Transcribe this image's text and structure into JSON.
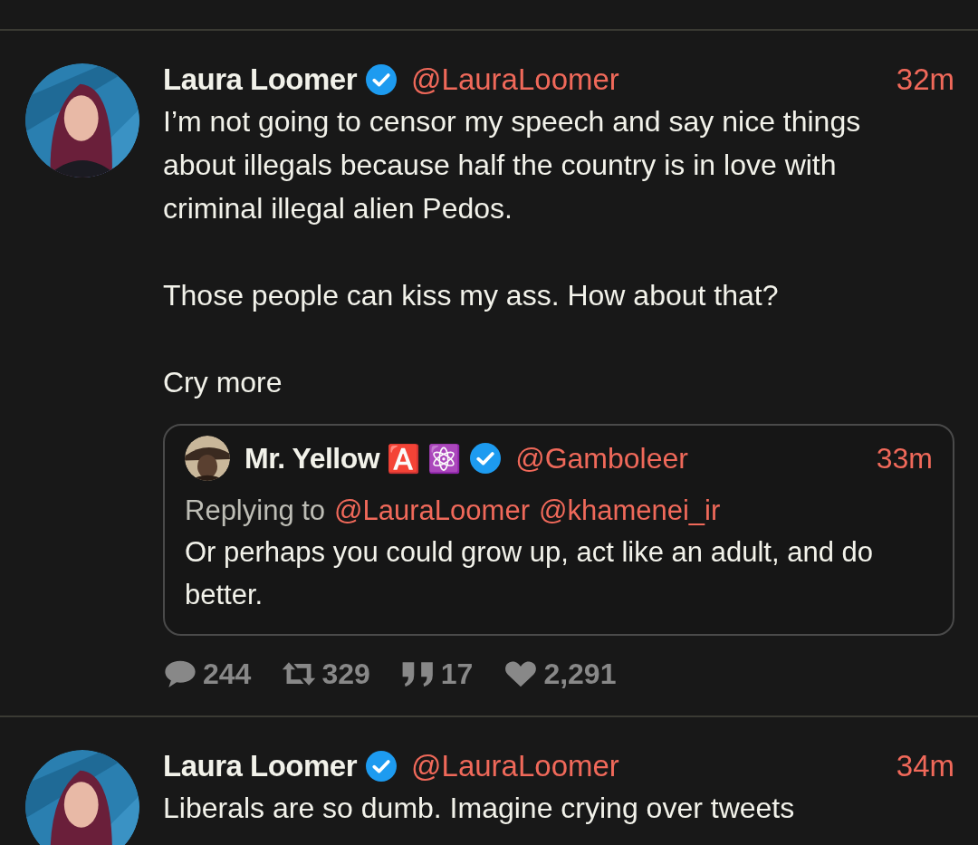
{
  "tweets": [
    {
      "name": "Laura Loomer",
      "verified": true,
      "handle": "@LauraLoomer",
      "time": "32m",
      "text": "I’m not going to censor my speech and say nice things about illegals because half the country is in love with criminal illegal alien Pedos.\n\nThose people can kiss my ass. How about that?\n\nCry more",
      "quote": {
        "name": "Mr. Yellow",
        "emojis": [
          "🅰️",
          "⚛️"
        ],
        "verified": true,
        "handle": "@Gamboleer",
        "time": "33m",
        "replying_label": "Replying to",
        "replying_to": [
          "@LauraLoomer",
          "@khamenei_ir"
        ],
        "text": "Or perhaps you could grow up, act like an adult, and do better."
      },
      "stats": [
        {
          "kind": "reply",
          "count": "244"
        },
        {
          "kind": "retweet",
          "count": "329"
        },
        {
          "kind": "quote",
          "count": "17"
        },
        {
          "kind": "like",
          "count": "2,291"
        }
      ]
    },
    {
      "name": "Laura Loomer",
      "verified": true,
      "handle": "@LauraLoomer",
      "time": "34m",
      "text": "Liberals are so dumb. Imagine crying over tweets"
    }
  ]
}
